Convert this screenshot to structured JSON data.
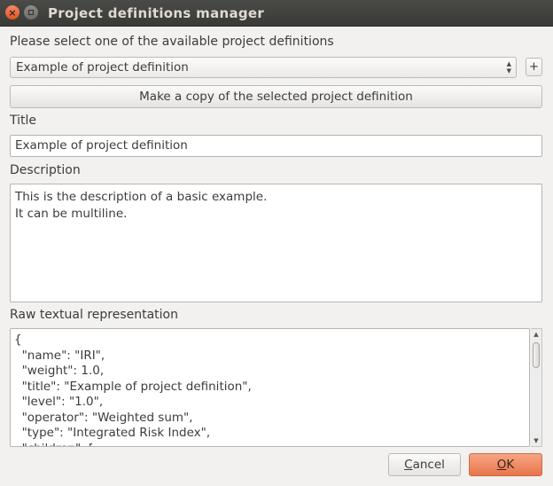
{
  "window": {
    "title": "Project definitions manager",
    "close_glyph": "×"
  },
  "selector": {
    "label": "Please select one of the available project definitions",
    "selected": "Example of project definition",
    "add_label": "+"
  },
  "copy_button": {
    "label": "Make a copy of the selected project definition"
  },
  "title_section": {
    "label": "Title",
    "value": "Example of project definition"
  },
  "description_section": {
    "label": "Description",
    "value": "This is the description of a basic example.\nIt can be multiline."
  },
  "raw_section": {
    "label": "Raw textual representation",
    "value": "{\n  \"name\": \"IRI\",\n  \"weight\": 1.0,\n  \"title\": \"Example of project definition\",\n  \"level\": \"1.0\",\n  \"operator\": \"Weighted sum\",\n  \"type\": \"Integrated Risk Index\",\n  \"children\": ["
  },
  "buttons": {
    "cancel_first": "C",
    "cancel_rest": "ancel",
    "ok_first": "O",
    "ok_rest": "K"
  },
  "colors": {
    "ok_accent": "#e8754a",
    "close_button": "#df5521",
    "titlebar": "#3c3b37"
  }
}
